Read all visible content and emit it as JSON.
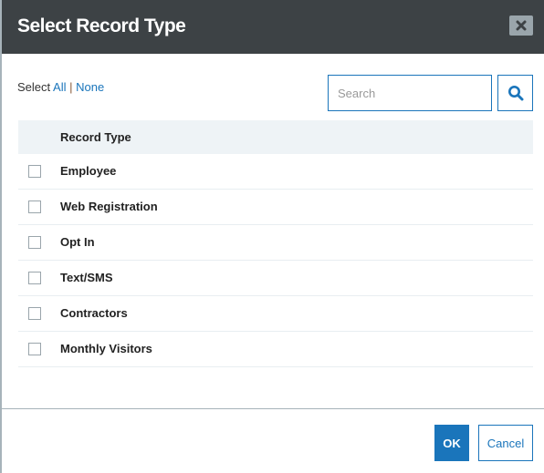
{
  "dialog": {
    "title": "Select Record Type",
    "close_icon": "close-icon"
  },
  "selection": {
    "label": "Select",
    "all_label": "All",
    "separator": "|",
    "none_label": "None"
  },
  "search": {
    "value": "",
    "placeholder": "Search",
    "icon": "search-icon"
  },
  "table": {
    "header": "Record Type",
    "rows": [
      {
        "label": "Employee",
        "checked": false
      },
      {
        "label": "Web Registration",
        "checked": false
      },
      {
        "label": "Opt In",
        "checked": false
      },
      {
        "label": "Text/SMS",
        "checked": false
      },
      {
        "label": "Contractors",
        "checked": false
      },
      {
        "label": "Monthly Visitors",
        "checked": false
      }
    ]
  },
  "footer": {
    "ok_label": "OK",
    "cancel_label": "Cancel"
  },
  "colors": {
    "header_bg": "#3d4245",
    "accent": "#1a75bb",
    "table_header_bg": "#eef3f6"
  }
}
